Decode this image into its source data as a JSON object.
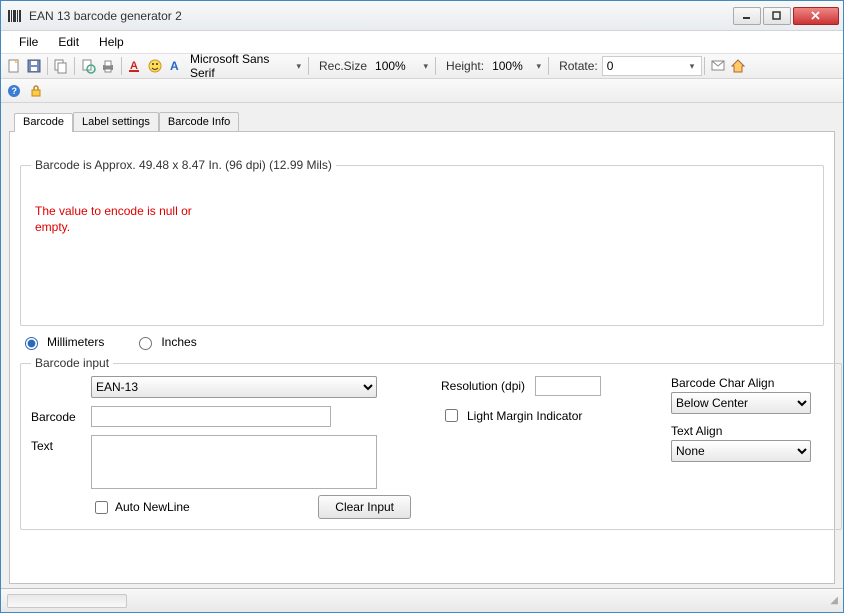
{
  "window": {
    "title": "EAN 13 barcode generator 2"
  },
  "menu": {
    "file": "File",
    "edit": "Edit",
    "help": "Help"
  },
  "toolbar": {
    "font": "Microsoft Sans Serif",
    "recsize_lbl": "Rec.Size",
    "recsize_val": "100%",
    "height_lbl": "Height:",
    "height_val": "100%",
    "rotate_lbl": "Rotate:",
    "rotate_val": "0"
  },
  "tabs": {
    "barcode": "Barcode",
    "label": "Label settings",
    "info": "Barcode Info"
  },
  "preview": {
    "legend": "Barcode is Approx. 49.48 x 8.47 In.  (96 dpi) (12.99 Mils)",
    "error": "The value to encode is null or empty.",
    "radio_mm": "Millimeters",
    "radio_in": "Inches"
  },
  "input": {
    "legend": "Barcode input",
    "type_sel": "EAN-13",
    "barcode_lbl": "Barcode",
    "text_lbl": "Text",
    "autonl": "Auto NewLine",
    "clear": "Clear Input",
    "resolution_lbl": "Resolution (dpi)",
    "lightmargin": "Light Margin Indicator",
    "charalign_lbl": "Barcode Char Align",
    "charalign_val": "Below Center",
    "textalign_lbl": "Text Align",
    "textalign_val": "None"
  }
}
